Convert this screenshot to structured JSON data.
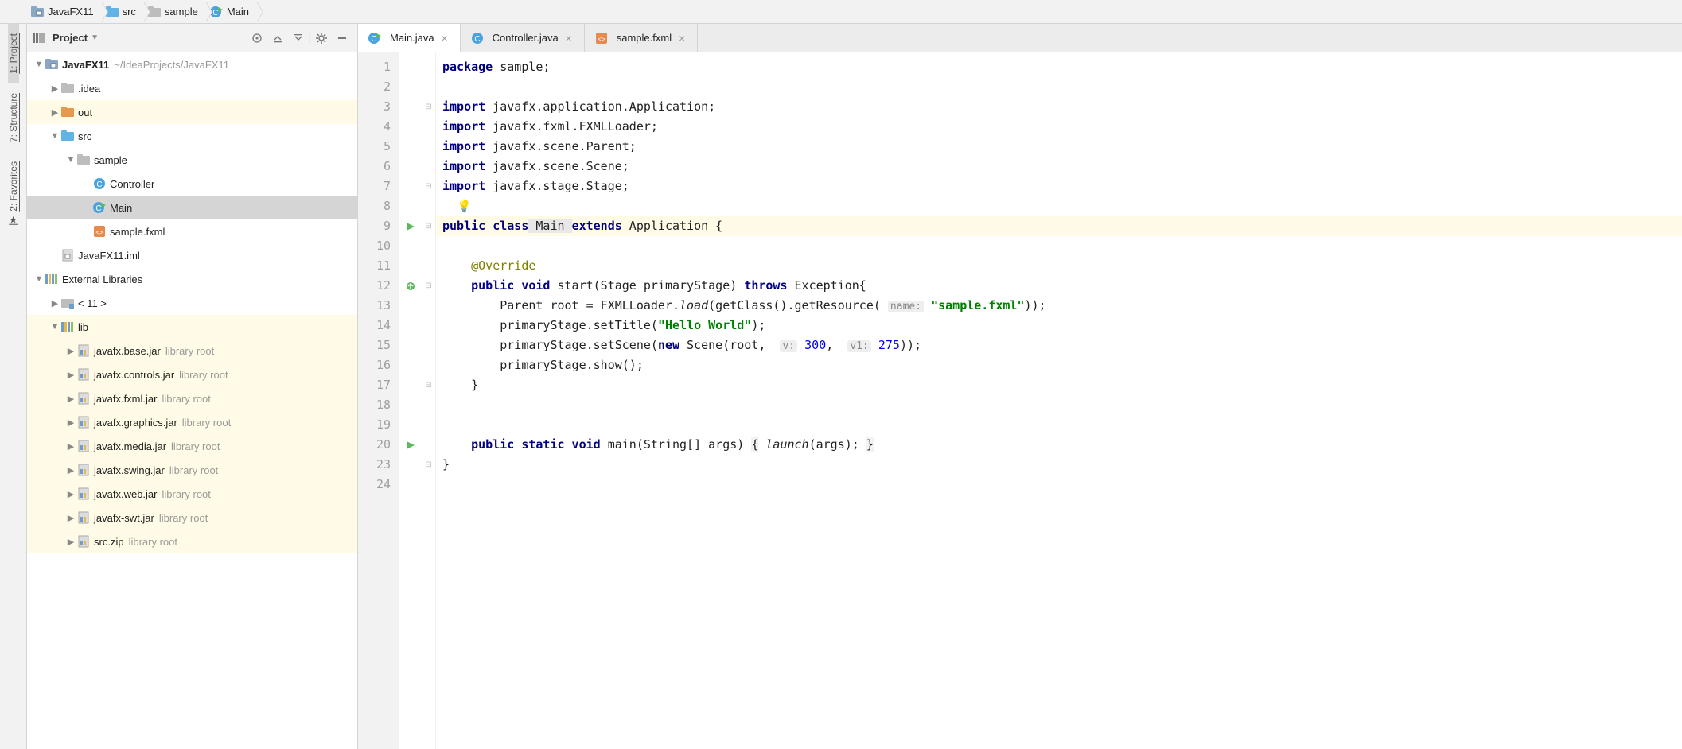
{
  "breadcrumbs": [
    {
      "icon": "module",
      "label": "JavaFX11"
    },
    {
      "icon": "folder-src",
      "label": "src"
    },
    {
      "icon": "folder",
      "label": "sample"
    },
    {
      "icon": "class-run",
      "label": "Main"
    }
  ],
  "rail": {
    "project": "1: Project",
    "structure": "7: Structure",
    "favorites": "2: Favorites"
  },
  "panel": {
    "title": "Project"
  },
  "tree": {
    "root": {
      "name": "JavaFX11",
      "hint": "~/IdeaProjects/JavaFX11"
    },
    "idea": ".idea",
    "out": "out",
    "src": "src",
    "sample": "sample",
    "controller": "Controller",
    "main": "Main",
    "fxml": "sample.fxml",
    "iml": "JavaFX11.iml",
    "extlib": "External Libraries",
    "jdk": "< 11 >",
    "lib": "lib",
    "jars": [
      {
        "name": "javafx.base.jar",
        "hint": "library root"
      },
      {
        "name": "javafx.controls.jar",
        "hint": "library root"
      },
      {
        "name": "javafx.fxml.jar",
        "hint": "library root"
      },
      {
        "name": "javafx.graphics.jar",
        "hint": "library root"
      },
      {
        "name": "javafx.media.jar",
        "hint": "library root"
      },
      {
        "name": "javafx.swing.jar",
        "hint": "library root"
      },
      {
        "name": "javafx.web.jar",
        "hint": "library root"
      },
      {
        "name": "javafx-swt.jar",
        "hint": "library root"
      },
      {
        "name": "src.zip",
        "hint": "library root"
      }
    ]
  },
  "tabs": [
    {
      "icon": "class-run",
      "label": "Main.java",
      "active": true
    },
    {
      "icon": "class",
      "label": "Controller.java",
      "active": false
    },
    {
      "icon": "fxml",
      "label": "sample.fxml",
      "active": false
    }
  ],
  "lines": [
    "1",
    "2",
    "3",
    "4",
    "5",
    "6",
    "7",
    "8",
    "9",
    "10",
    "11",
    "12",
    "13",
    "14",
    "15",
    "16",
    "17",
    "18",
    "19",
    "20",
    "23",
    "24"
  ],
  "code": {
    "l1": {
      "kw": "package",
      "rest": " sample;"
    },
    "l3": {
      "kw": "import",
      "rest": " javafx.application.Application;"
    },
    "l4": {
      "kw": "import",
      "rest": " javafx.fxml.FXMLLoader;"
    },
    "l5": {
      "kw": "import",
      "rest": " javafx.scene.Parent;"
    },
    "l6": {
      "kw": "import",
      "rest": " javafx.scene.Scene;"
    },
    "l7": {
      "kw": "import",
      "rest": " javafx.stage.Stage;"
    },
    "l9": {
      "p1": "public class",
      "cls": " Main ",
      "p2": "extends",
      "rest": " Application {"
    },
    "l11": "    @Override",
    "l12": {
      "p1": "    public void",
      "mid": " start(Stage primaryStage) ",
      "p2": "throws",
      "rest": " Exception{"
    },
    "l13": {
      "pre": "        Parent root = FXMLLoader.",
      "it": "load",
      "mid1": "(getClass().getResource( ",
      "hint": "name:",
      "str": " \"sample.fxml\"",
      "post": "));"
    },
    "l14": {
      "pre": "        primaryStage.setTitle(",
      "str": "\"Hello World\"",
      "post": ");"
    },
    "l15": {
      "pre": "        primaryStage.setScene(",
      "kw": "new",
      "mid": " Scene(root,  ",
      "h1": "v:",
      "v1": " 300",
      "sep": ",  ",
      "h2": "v1:",
      "v2": " 275",
      "post": "));"
    },
    "l16": "        primaryStage.show();",
    "l17": "    }",
    "l20": {
      "p1": "    public static void",
      "mid": " main(String[] args) ",
      "b1": "{",
      "it": " launch",
      "args": "(args); ",
      "b2": "}"
    },
    "l23": "}"
  }
}
